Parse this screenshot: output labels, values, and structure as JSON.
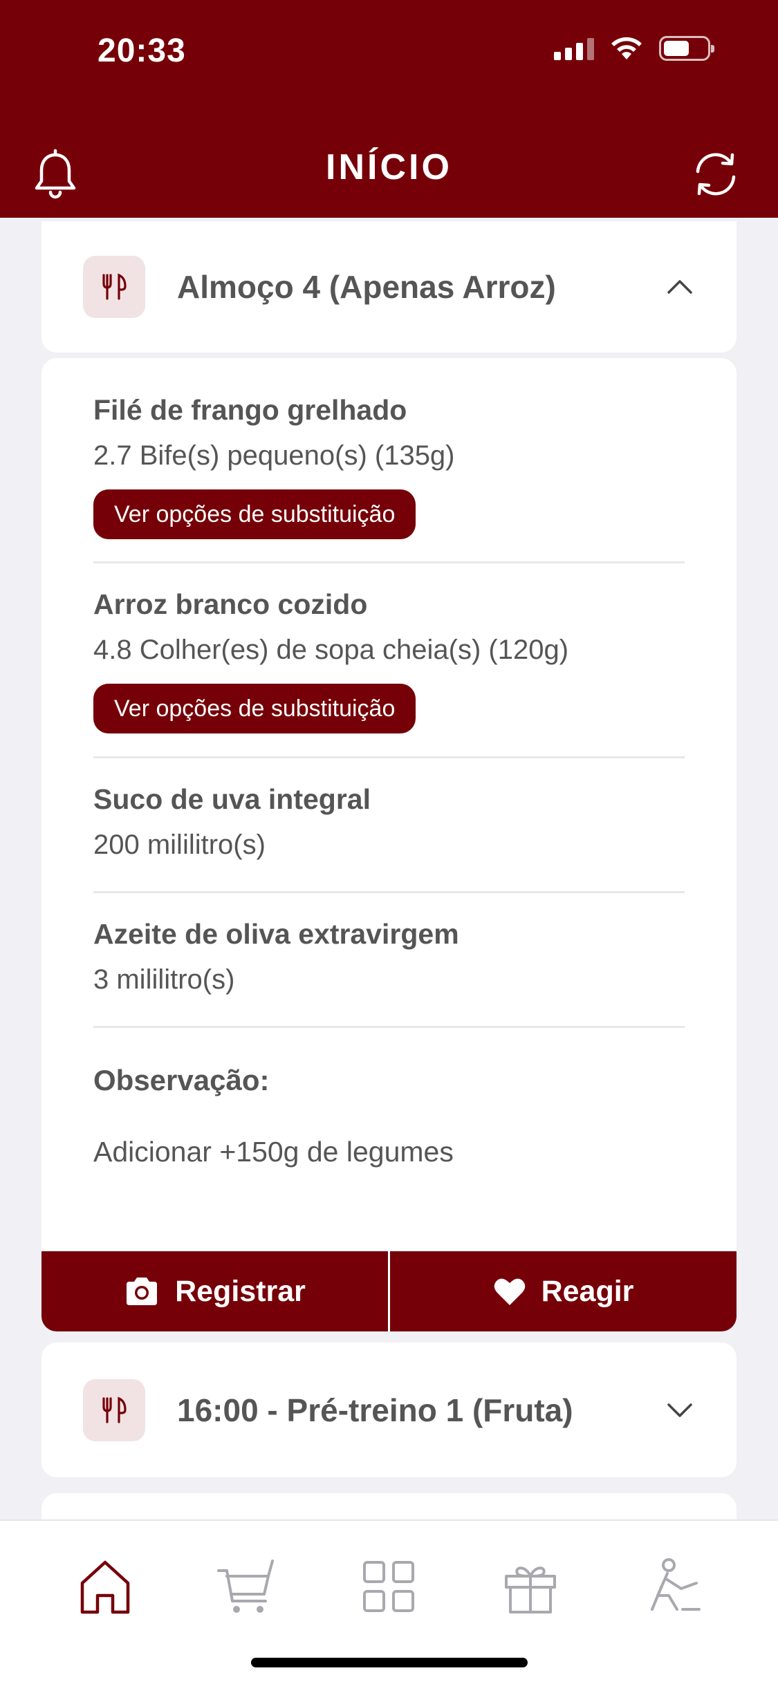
{
  "status_bar": {
    "time": "20:33"
  },
  "header": {
    "title": "INÍCIO"
  },
  "meal_expanded": {
    "title": "Almoço 4 (Apenas Arroz)",
    "items": [
      {
        "name": "Filé de frango grelhado",
        "quantity": "2.7 Bife(s) pequeno(s) (135g)",
        "button": "Ver opções de substituição"
      },
      {
        "name": "Arroz branco cozido",
        "quantity": "4.8 Colher(es) de sopa cheia(s) (120g)",
        "button": "Ver opções de substituição"
      },
      {
        "name": "Suco de uva integral",
        "quantity": "200 mililitro(s)"
      },
      {
        "name": "Azeite de oliva extravirgem",
        "quantity": "3 mililitro(s)"
      }
    ],
    "observation_label": "Observação:",
    "observation_text": "Adicionar +150g de legumes",
    "register_label": "Registrar",
    "react_label": "Reagir"
  },
  "meal_collapsed": {
    "title": "16:00 - Pré-treino 1 (Fruta)"
  },
  "colors": {
    "brand": "#760008",
    "icon_bg": "#f1e3e4",
    "background": "#f0f0f5"
  },
  "bottom_nav": {
    "items": [
      "home-icon",
      "cart-icon",
      "grid-icon",
      "gift-icon",
      "exercise-icon"
    ],
    "active": "home-icon"
  }
}
